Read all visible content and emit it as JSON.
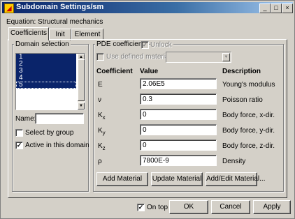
{
  "window": {
    "title": "Subdomain Settings/sm"
  },
  "titlebar_buttons": [
    "_",
    "□",
    "×"
  ],
  "equation_label": "Equation: Structural mechanics",
  "tabs": [
    {
      "label": "Coefficients",
      "active": true
    },
    {
      "label": "Init",
      "active": false
    },
    {
      "label": "Element",
      "active": false
    }
  ],
  "domain_selection": {
    "label": "Domain selection",
    "items": [
      "1",
      "2",
      "3",
      "4",
      "5"
    ],
    "name_label": "Name:",
    "name_value": "",
    "select_by_group": {
      "label": "Select by group",
      "checked": false
    },
    "active_in_domain": {
      "label": "Active in this domain",
      "checked": true
    }
  },
  "pde": {
    "label": "PDE coefficients",
    "unlock": {
      "label": "Unlock",
      "checked": true,
      "enabled": false
    },
    "use_defined_material": {
      "label": "Use defined material",
      "checked": false,
      "enabled": false
    },
    "material_select": {
      "value": ""
    },
    "headers": {
      "coefficient": "Coefficient",
      "value": "Value",
      "description": "Description"
    },
    "rows": [
      {
        "coef": "E",
        "sub": "",
        "value": "2.06E5",
        "description": "Young's modulus"
      },
      {
        "coef": "ν",
        "sub": "",
        "value": "0.3",
        "description": "Poisson ratio"
      },
      {
        "coef": "K",
        "sub": "x",
        "value": "0",
        "description": "Body force, x-dir."
      },
      {
        "coef": "K",
        "sub": "y",
        "value": "0",
        "description": "Body force, y-dir."
      },
      {
        "coef": "K",
        "sub": "z",
        "value": "0",
        "description": "Body force, z-dir."
      },
      {
        "coef": "ρ",
        "sub": "",
        "value": "7800E-9",
        "description": "Density"
      }
    ],
    "buttons": {
      "add": "Add Material",
      "update": "Update Material",
      "edit": "Add/Edit Material..."
    }
  },
  "footer": {
    "on_top": {
      "label": "On top",
      "checked": true
    },
    "ok": "OK",
    "cancel": "Cancel",
    "apply": "Apply"
  },
  "icons": {
    "title_icon": "app-icon",
    "check_glyph": "✓"
  }
}
